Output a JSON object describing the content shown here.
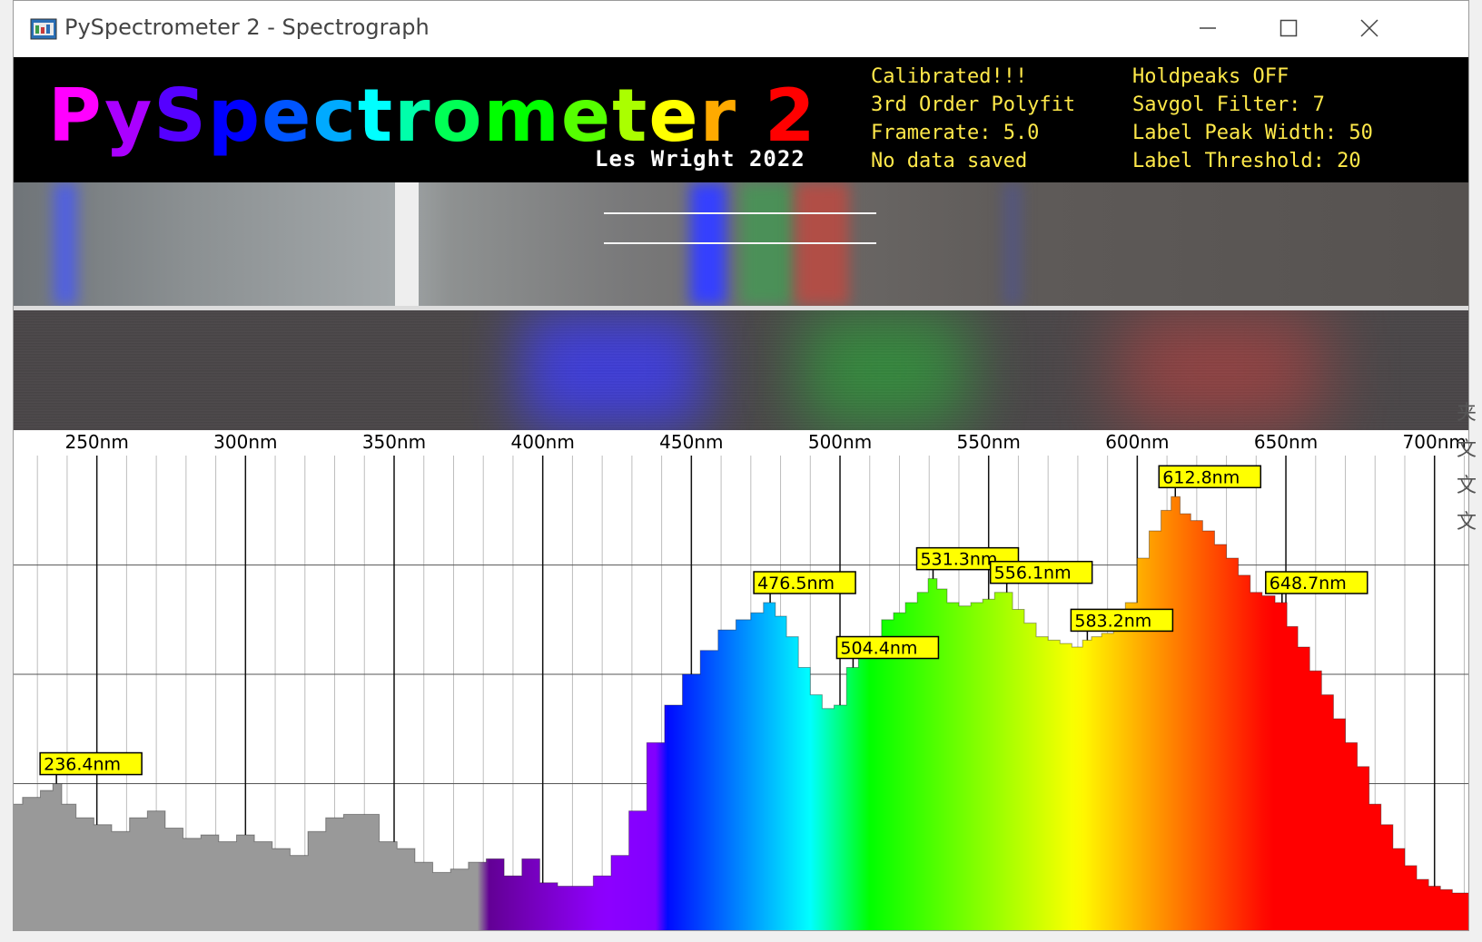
{
  "window": {
    "title": "PySpectrometer 2 - Spectrograph",
    "icon": "spectrograph-app-icon",
    "controls": [
      "minimize-icon",
      "maximize-icon",
      "close-icon"
    ]
  },
  "header": {
    "logo_text": "PySpectrometer 2",
    "author": "Les Wright 2022",
    "status_left": [
      "Calibrated!!!",
      "3rd Order Polyfit",
      "Framerate: 5.0",
      "No data saved"
    ],
    "status_right": [
      "Holdpeaks OFF",
      "Savgol Filter: 7",
      "Label Peak Width: 50",
      "Label Threshold: 20"
    ],
    "status_color": "#ffe94a"
  },
  "chart_data": {
    "type": "area",
    "xlabel": "",
    "ylabel": "",
    "x_ticks": [
      "250nm",
      "300nm",
      "350nm",
      "400nm",
      "450nm",
      "500nm",
      "550nm",
      "600nm",
      "650nm",
      "700nm"
    ],
    "x_tick_values": [
      250,
      300,
      350,
      400,
      450,
      500,
      550,
      600,
      650,
      700
    ],
    "xlim": [
      222,
      712
    ],
    "ylim": [
      0,
      255
    ],
    "grid": true,
    "peak_labels": [
      {
        "label": "236.4nm",
        "x": 236.4,
        "y": 64
      },
      {
        "label": "476.5nm",
        "x": 476.5,
        "y": 170
      },
      {
        "label": "504.4nm",
        "x": 504.4,
        "y": 132
      },
      {
        "label": "531.3nm",
        "x": 531.3,
        "y": 184
      },
      {
        "label": "556.1nm",
        "x": 556.1,
        "y": 176
      },
      {
        "label": "583.2nm",
        "x": 583.2,
        "y": 148
      },
      {
        "label": "612.8nm",
        "x": 612.8,
        "y": 232
      },
      {
        "label": "648.7nm",
        "x": 648.7,
        "y": 170
      }
    ],
    "series": [
      {
        "x": [
          222,
          228,
          234,
          236.4,
          240,
          246,
          252,
          258,
          264,
          270,
          276,
          282,
          288,
          294,
          300,
          306,
          312,
          318,
          324,
          330,
          336,
          342,
          348,
          354,
          360,
          366,
          372,
          378,
          384,
          390,
          396,
          402,
          408,
          414,
          420,
          426,
          432,
          438,
          444,
          450,
          456,
          462,
          468,
          472,
          476.5,
          480,
          484,
          488,
          492,
          496,
          500,
          504.4,
          508,
          512,
          516,
          520,
          524,
          528,
          531.3,
          534,
          538,
          542,
          546,
          550,
          554,
          556.1,
          560,
          564,
          568,
          572,
          576,
          580,
          583.2,
          586,
          590,
          594,
          598,
          602,
          606,
          610,
          612.8,
          616,
          620,
          624,
          628,
          632,
          636,
          640,
          644,
          648.7,
          652,
          656,
          660,
          664,
          668,
          672,
          676,
          680,
          684,
          688,
          692,
          696,
          700,
          704,
          708,
          712
        ],
        "y": [
          52,
          56,
          60,
          64,
          52,
          44,
          40,
          36,
          44,
          48,
          38,
          32,
          34,
          30,
          34,
          30,
          26,
          22,
          36,
          44,
          46,
          46,
          30,
          26,
          18,
          12,
          14,
          18,
          20,
          10,
          20,
          6,
          4,
          4,
          10,
          22,
          48,
          88,
          110,
          128,
          142,
          154,
          160,
          164,
          170,
          162,
          150,
          132,
          116,
          108,
          110,
          132,
          140,
          150,
          160,
          164,
          170,
          176,
          184,
          178,
          170,
          168,
          170,
          172,
          176,
          176,
          166,
          158,
          150,
          148,
          146,
          144,
          148,
          150,
          152,
          160,
          170,
          196,
          212,
          224,
          232,
          222,
          218,
          212,
          204,
          196,
          186,
          176,
          174,
          170,
          156,
          144,
          130,
          116,
          102,
          88,
          74,
          52,
          40,
          26,
          16,
          8,
          4,
          2,
          0,
          0
        ]
      }
    ]
  },
  "side_glyphs": [
    "夹",
    "文",
    "文",
    "文"
  ]
}
